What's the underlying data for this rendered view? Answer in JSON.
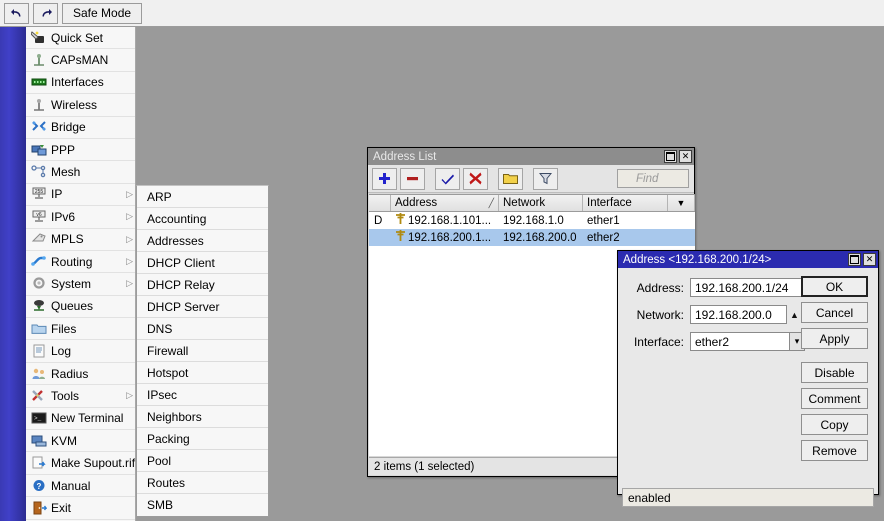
{
  "toolbar": {
    "undo_icon": "undo-arrow-icon",
    "redo_icon": "redo-arrow-icon",
    "safe_mode_label": "Safe Mode"
  },
  "sidebar": {
    "items": [
      {
        "label": "Quick Set",
        "icon": "quick-set-icon",
        "arrow": ""
      },
      {
        "label": "CAPsMAN",
        "icon": "capsman-icon",
        "arrow": ""
      },
      {
        "label": "Interfaces",
        "icon": "interfaces-icon",
        "arrow": ""
      },
      {
        "label": "Wireless",
        "icon": "wireless-icon",
        "arrow": ""
      },
      {
        "label": "Bridge",
        "icon": "bridge-icon",
        "arrow": ""
      },
      {
        "label": "PPP",
        "icon": "ppp-icon",
        "arrow": ""
      },
      {
        "label": "Mesh",
        "icon": "mesh-icon",
        "arrow": ""
      },
      {
        "label": "IP",
        "icon": "ip-icon",
        "arrow": "▷"
      },
      {
        "label": "IPv6",
        "icon": "ipv6-icon",
        "arrow": "▷"
      },
      {
        "label": "MPLS",
        "icon": "mpls-icon",
        "arrow": "▷"
      },
      {
        "label": "Routing",
        "icon": "routing-icon",
        "arrow": "▷"
      },
      {
        "label": "System",
        "icon": "system-icon",
        "arrow": "▷"
      },
      {
        "label": "Queues",
        "icon": "queues-icon",
        "arrow": ""
      },
      {
        "label": "Files",
        "icon": "files-icon",
        "arrow": ""
      },
      {
        "label": "Log",
        "icon": "log-icon",
        "arrow": ""
      },
      {
        "label": "Radius",
        "icon": "radius-icon",
        "arrow": ""
      },
      {
        "label": "Tools",
        "icon": "tools-icon",
        "arrow": "▷"
      },
      {
        "label": "New Terminal",
        "icon": "terminal-icon",
        "arrow": ""
      },
      {
        "label": "KVM",
        "icon": "kvm-icon",
        "arrow": ""
      },
      {
        "label": "Make Supout.rif",
        "icon": "supout-icon",
        "arrow": ""
      },
      {
        "label": "Manual",
        "icon": "manual-icon",
        "arrow": ""
      },
      {
        "label": "Exit",
        "icon": "exit-icon",
        "arrow": ""
      }
    ]
  },
  "submenu": {
    "parent": "IP",
    "items": [
      {
        "label": "ARP"
      },
      {
        "label": "Accounting"
      },
      {
        "label": "Addresses"
      },
      {
        "label": "DHCP Client"
      },
      {
        "label": "DHCP Relay"
      },
      {
        "label": "DHCP Server"
      },
      {
        "label": "DNS"
      },
      {
        "label": "Firewall"
      },
      {
        "label": "Hotspot"
      },
      {
        "label": "IPsec"
      },
      {
        "label": "Neighbors"
      },
      {
        "label": "Packing"
      },
      {
        "label": "Pool"
      },
      {
        "label": "Routes"
      },
      {
        "label": "SMB"
      }
    ]
  },
  "address_list_window": {
    "title": "Address List",
    "toolbar": {
      "add_icon": "plus-icon",
      "remove_icon": "minus-icon",
      "enable_icon": "check-icon",
      "disable_icon": "cross-icon",
      "comment_icon": "comment-note-icon",
      "filter_icon": "funnel-filter-icon",
      "find_placeholder": "Find"
    },
    "columns": [
      "",
      "Address",
      "Network",
      "Interface",
      ""
    ],
    "sort_indicator": "╱",
    "column_menu_icon": "chevron-down-icon",
    "rows": [
      {
        "flag": "D",
        "address": "192.168.1.101...",
        "network": "192.168.1.0",
        "interface": "ether1",
        "selected": false,
        "row_icon": "address-pin-icon"
      },
      {
        "flag": "",
        "address": "192.168.200.1...",
        "network": "192.168.200.0",
        "interface": "ether2",
        "selected": true,
        "row_icon": "address-pin-icon"
      }
    ],
    "status": "2 items (1 selected)",
    "maximize_icon": "maximize-icon",
    "close_icon": "close-icon"
  },
  "address_dialog": {
    "title": "Address <192.168.200.1/24>",
    "maximize_icon": "maximize-icon",
    "close_icon": "close-icon",
    "fields": [
      {
        "label": "Address:",
        "value": "192.168.200.1/24",
        "control": "none"
      },
      {
        "label": "Network:",
        "value": "192.168.200.0",
        "control": "up-arrow",
        "control_icon": "arrow-up-icon"
      },
      {
        "label": "Interface:",
        "value": "ether2",
        "control": "dropdown",
        "control_icon": "dropdown-arrow-icon"
      }
    ],
    "buttons": [
      {
        "label": "OK",
        "primary": true
      },
      {
        "label": "Cancel",
        "primary": false
      },
      {
        "label": "Apply",
        "primary": false
      },
      {
        "label": "Disable",
        "primary": false
      },
      {
        "label": "Comment",
        "primary": false
      },
      {
        "label": "Copy",
        "primary": false
      },
      {
        "label": "Remove",
        "primary": false
      }
    ],
    "status": "enabled"
  },
  "colors": {
    "selection_blue": "#a8c8ec",
    "active_title": "#2b2bb0",
    "inactive_title": "#8d8d8d",
    "desktop": "#9a9a9a",
    "strip_blue": "#3a3ab4"
  }
}
